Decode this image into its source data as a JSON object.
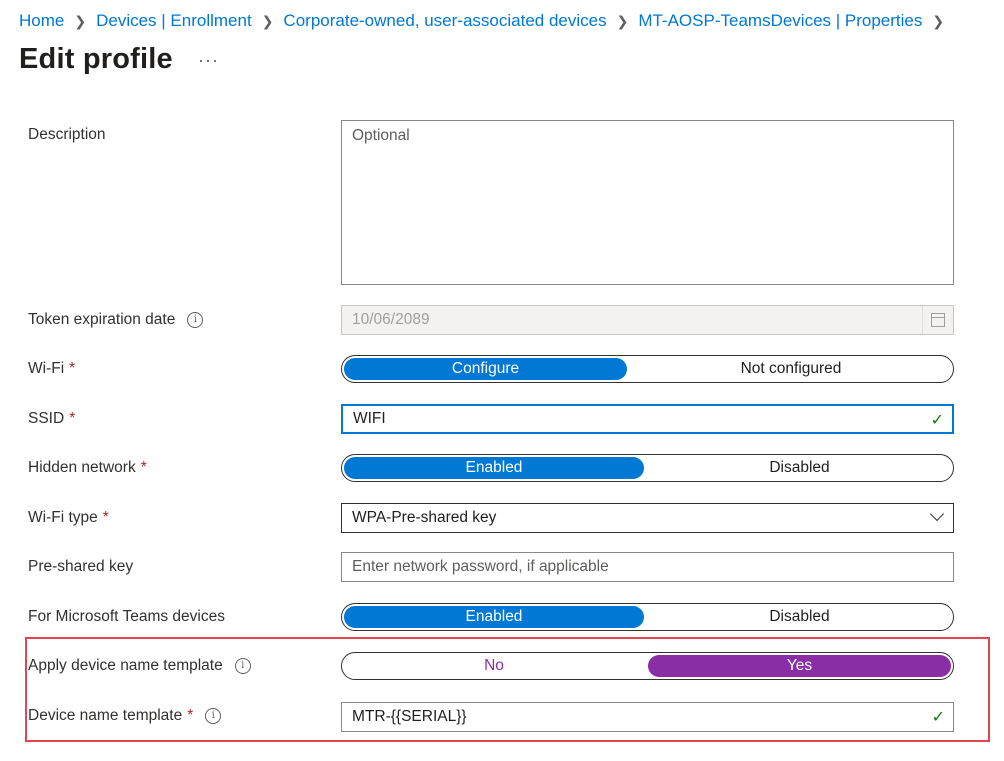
{
  "breadcrumb": [
    "Home",
    "Devices | Enrollment",
    "Corporate-owned, user-associated devices",
    "MT-AOSP-TeamsDevices | Properties"
  ],
  "page_title": "Edit profile",
  "more_label": "···",
  "form": {
    "description": {
      "label": "Description",
      "placeholder": "Optional"
    },
    "token_expiration": {
      "label": "Token expiration date",
      "value": "10/06/2089"
    },
    "wifi": {
      "label": "Wi-Fi",
      "options": [
        "Configure",
        "Not configured"
      ],
      "selected": "Configure"
    },
    "ssid": {
      "label": "SSID",
      "value": "WIFI"
    },
    "hidden_network": {
      "label": "Hidden network",
      "options": [
        "Enabled",
        "Disabled"
      ],
      "selected": "Enabled"
    },
    "wifi_type": {
      "label": "Wi-Fi type",
      "value": "WPA-Pre-shared key"
    },
    "pre_shared_key": {
      "label": "Pre-shared key",
      "placeholder": "Enter network password, if applicable"
    },
    "teams_devices": {
      "label": "For Microsoft Teams devices",
      "options": [
        "Enabled",
        "Disabled"
      ],
      "selected": "Enabled"
    },
    "apply_template": {
      "label": "Apply device name template",
      "options": [
        "No",
        "Yes"
      ],
      "selected": "Yes"
    },
    "device_name_template": {
      "label": "Device name template",
      "value": "MTR-{{SERIAL}}"
    }
  },
  "required_mark": "*",
  "colors": {
    "link": "#0078d4",
    "selected_toggle": "#0078d4",
    "template_toggle": "#8a2ea6",
    "highlight": "#e2474f",
    "required": "#a4262c",
    "valid_check": "#107c10"
  }
}
